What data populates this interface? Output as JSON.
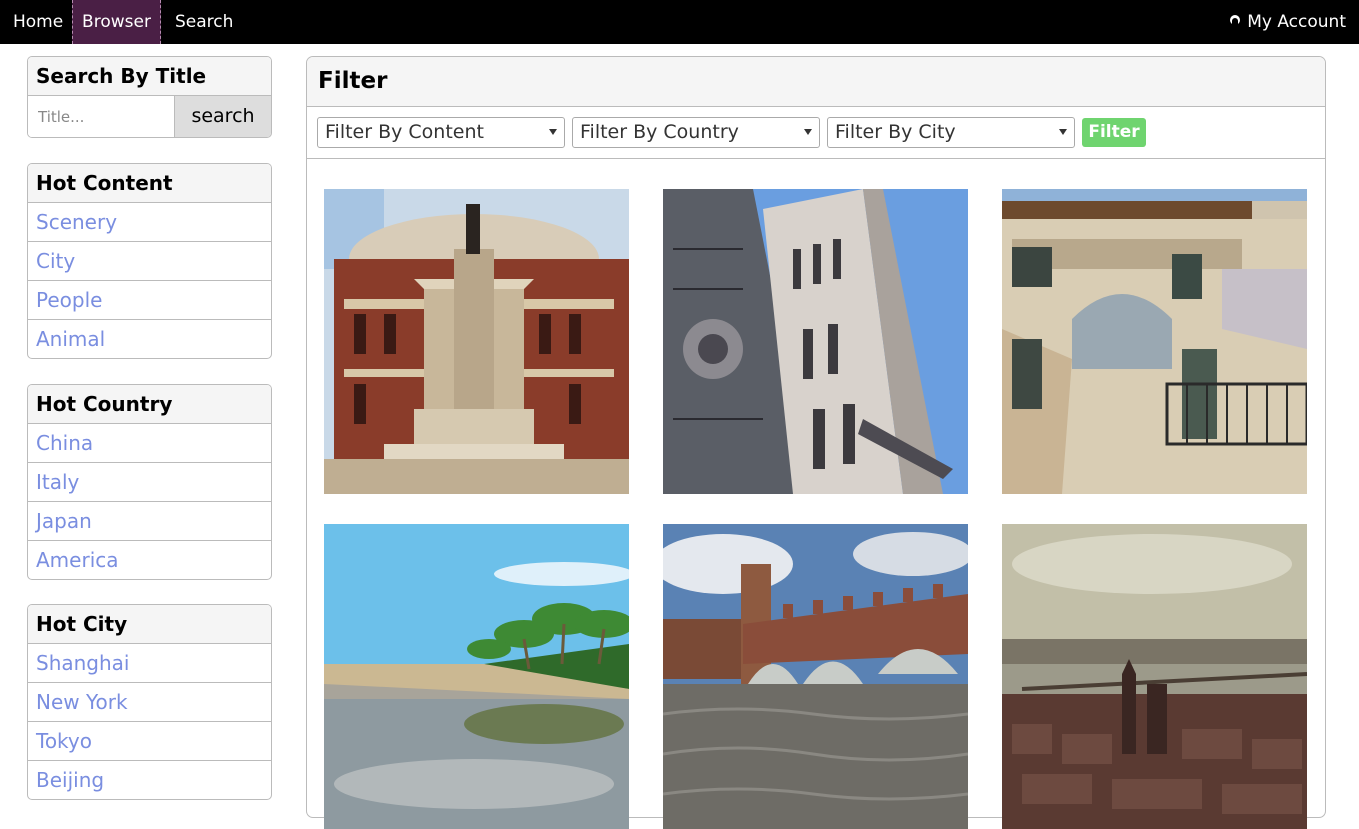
{
  "nav": {
    "home": "Home",
    "browser": "Browser",
    "search": "Search",
    "account": "My Account"
  },
  "search_by_title": {
    "heading": "Search By Title",
    "placeholder": "Title...",
    "button": "search"
  },
  "hot_content": {
    "heading": "Hot Content",
    "items": [
      "Scenery",
      "City",
      "People",
      "Animal"
    ]
  },
  "hot_country": {
    "heading": "Hot Country",
    "items": [
      "China",
      "Italy",
      "Japan",
      "America"
    ]
  },
  "hot_city": {
    "heading": "Hot City",
    "items": [
      "Shanghai",
      "New York",
      "Tokyo",
      "Beijing"
    ]
  },
  "filter": {
    "heading": "Filter",
    "content_select": "Filter By Content",
    "country_select": "Filter By Country",
    "city_select": "Filter By City",
    "button": "Filter",
    "button_color": "#6fd46f"
  },
  "colors": {
    "nav_bg": "#000000",
    "nav_active": "#4a1f45",
    "link": "#7a8ee0"
  }
}
